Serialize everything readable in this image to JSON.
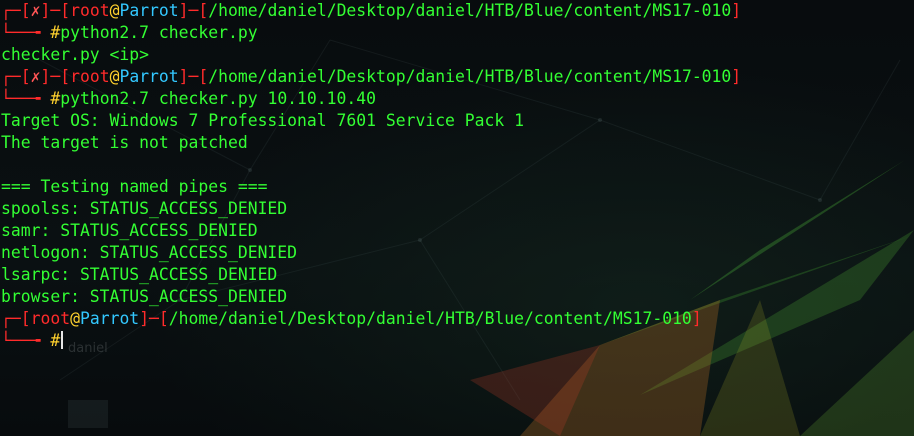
{
  "prompt": {
    "user": "root",
    "at": "@",
    "host": "Parrot",
    "cwd": "/home/daniel/Desktop/daniel/HTB/Blue/content/MS17-010",
    "error_mark": "✗",
    "corner_top": "┌─[",
    "corner_bottom": "└──╼ ",
    "symbol": "#"
  },
  "commands": {
    "first": "python2.7 checker.py",
    "second": "python2.7 checker.py 10.10.10.40"
  },
  "output": {
    "usage": "checker.py <ip>",
    "target_os": "Target OS: Windows 7 Professional 7601 Service Pack 1",
    "patched": "The target is not patched",
    "pipes_header": "=== Testing named pipes ===",
    "pipes": [
      "spoolss: STATUS_ACCESS_DENIED",
      "samr: STATUS_ACCESS_DENIED",
      "netlogon: STATUS_ACCESS_DENIED",
      "lsarpc: STATUS_ACCESS_DENIED",
      "browser: STATUS_ACCESS_DENIED"
    ]
  },
  "desktop_ghost_label": "daniel",
  "colors": {
    "prompt_red": "#ff2b2b",
    "host_cyan": "#33c8ff",
    "symbol_yellow": "#ffd12e",
    "output_green": "#33ff33",
    "background": "#070b0d"
  }
}
